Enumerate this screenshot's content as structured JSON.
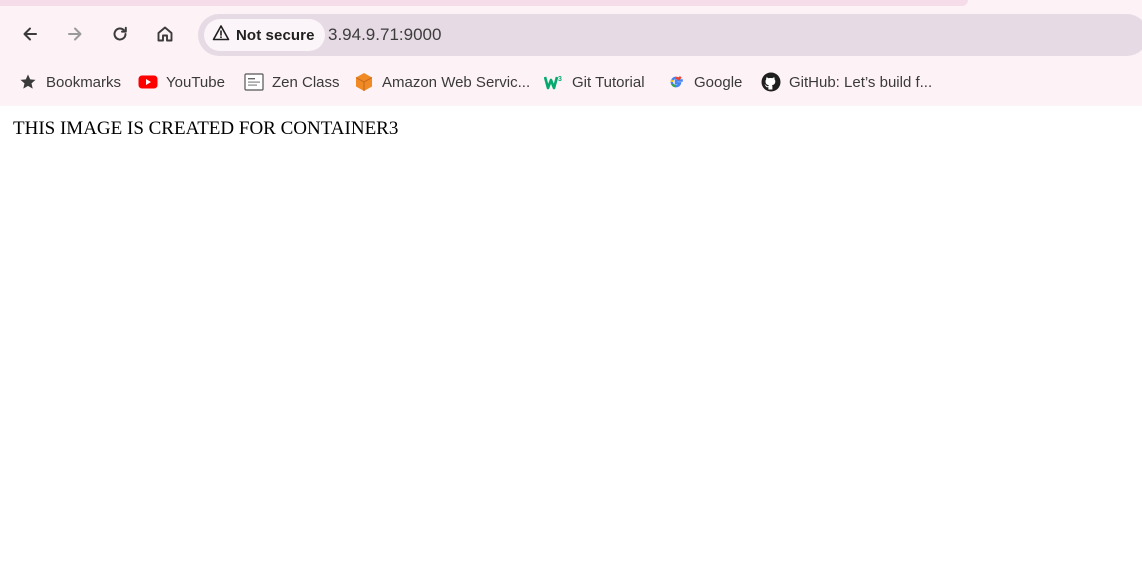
{
  "browser": {
    "security_label": "Not secure",
    "url": "3.94.9.71:9000",
    "nav": {
      "back_icon": "arrow-left-icon",
      "forward_icon": "arrow-right-icon",
      "reload_icon": "reload-icon",
      "home_icon": "home-icon"
    }
  },
  "bookmarks": [
    {
      "label": "Bookmarks",
      "icon": "star-icon"
    },
    {
      "label": "YouTube",
      "icon": "youtube-icon"
    },
    {
      "label": "Zen Class",
      "icon": "zen-class-icon"
    },
    {
      "label": "Amazon Web Servic...",
      "icon": "aws-icon"
    },
    {
      "label": "Git Tutorial",
      "icon": "w3schools-icon"
    },
    {
      "label": "Google",
      "icon": "google-icon"
    },
    {
      "label": "GitHub: Let’s build f...",
      "icon": "github-icon"
    }
  ],
  "page": {
    "body_text": "THIS IMAGE IS CREATED FOR CONTAINER3"
  },
  "colors": {
    "chrome_background": "#fdf2f6",
    "omnibox_background": "#e6dbe4",
    "youtube_red": "#ff0000",
    "aws_orange": "#f08a24",
    "w3_green": "#04aa6d"
  }
}
